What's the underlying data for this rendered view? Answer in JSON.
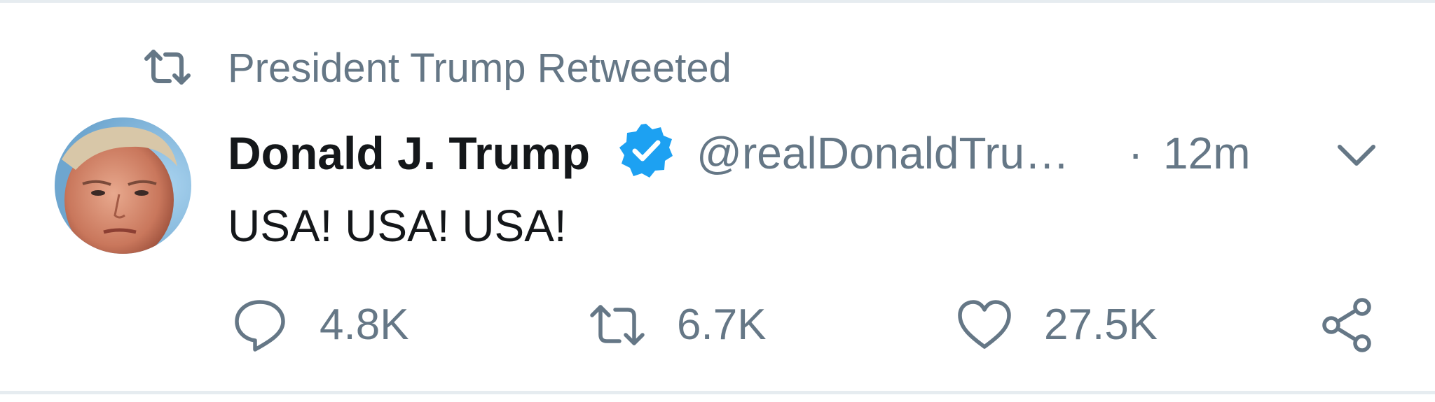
{
  "context": {
    "icon": "retweet-icon",
    "text": "President Trump Retweeted"
  },
  "tweet": {
    "avatar": "avatar-photo",
    "display_name": "Donald J. Trump",
    "verified_icon": "verified-badge-icon",
    "handle": "@realDonaldTru…",
    "separator": "·",
    "timestamp": "12m",
    "menu_icon": "chevron-down-icon",
    "text": "USA! USA! USA!"
  },
  "actions": {
    "reply": {
      "icon": "reply-icon",
      "count": "4.8K"
    },
    "retweet": {
      "icon": "retweet-icon",
      "count": "6.7K"
    },
    "like": {
      "icon": "heart-icon",
      "count": "27.5K"
    },
    "share": {
      "icon": "share-icon"
    }
  },
  "colors": {
    "primary_text": "#14171a",
    "secondary_text": "#657786",
    "verified_blue": "#1da1f2",
    "divider": "#e6ecf0"
  }
}
